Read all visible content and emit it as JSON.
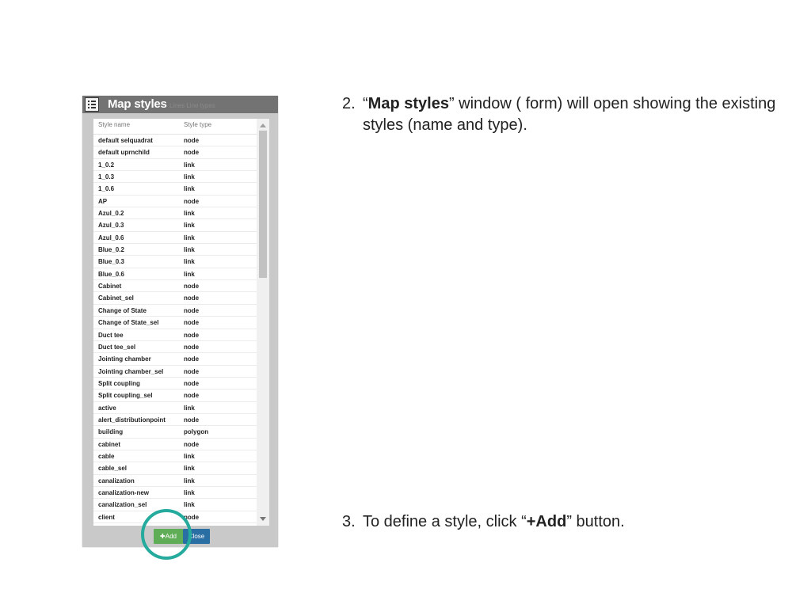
{
  "window": {
    "title": "Map styles",
    "ghost_text": "Lines        Line types"
  },
  "table": {
    "columns": [
      "Style name",
      "Style type"
    ],
    "rows": [
      [
        "default selquadrat",
        "node"
      ],
      [
        "default uprnchild",
        "node"
      ],
      [
        "1_0.2",
        "link"
      ],
      [
        "1_0.3",
        "link"
      ],
      [
        "1_0.6",
        "link"
      ],
      [
        "AP",
        "node"
      ],
      [
        "Azul_0.2",
        "link"
      ],
      [
        "Azul_0.3",
        "link"
      ],
      [
        "Azul_0.6",
        "link"
      ],
      [
        "Blue_0.2",
        "link"
      ],
      [
        "Blue_0.3",
        "link"
      ],
      [
        "Blue_0.6",
        "link"
      ],
      [
        "Cabinet",
        "node"
      ],
      [
        "Cabinet_sel",
        "node"
      ],
      [
        "Change of State",
        "node"
      ],
      [
        "Change of State_sel",
        "node"
      ],
      [
        "Duct tee",
        "node"
      ],
      [
        "Duct tee_sel",
        "node"
      ],
      [
        "Jointing chamber",
        "node"
      ],
      [
        "Jointing chamber_sel",
        "node"
      ],
      [
        "Split coupling",
        "node"
      ],
      [
        "Split coupling_sel",
        "node"
      ],
      [
        "active",
        "link"
      ],
      [
        "alert_distributionpoint",
        "node"
      ],
      [
        "building",
        "polygon"
      ],
      [
        "cabinet",
        "node"
      ],
      [
        "cable",
        "link"
      ],
      [
        "cable_sel",
        "link"
      ],
      [
        "canalization",
        "link"
      ],
      [
        "canalization-new",
        "link"
      ],
      [
        "canalization_sel",
        "link"
      ],
      [
        "client",
        "node"
      ]
    ]
  },
  "buttons": {
    "add_label": "✚Add",
    "close_label": "Close"
  },
  "colors": {
    "add_button": "#5fad56",
    "close_button": "#2a6fa3",
    "highlight_ring": "#25ab9d",
    "titlebar": "#737373"
  },
  "instructions": {
    "step2_num": "2.",
    "step2_open": "“",
    "step2_bold": "Map styles",
    "step2_rest": "” window ( form) will open showing the existing styles (name and type).",
    "step3_num": "3.",
    "step3_pre": "To define a style, click “",
    "step3_bold": "+Add",
    "step3_post": "” button."
  }
}
